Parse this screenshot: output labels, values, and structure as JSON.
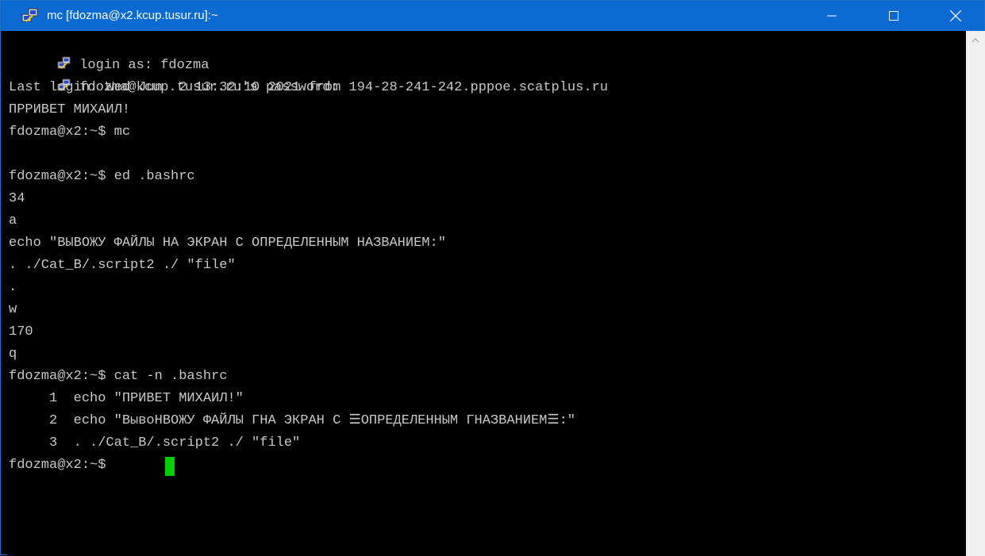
{
  "window": {
    "title": "mc [fdozma@x2.kcup.tusur.ru]:~",
    "icon": "putty-icon",
    "accent_color": "#0a6ad1"
  },
  "controls": {
    "minimize_icon": "minimize-icon",
    "maximize_icon": "maximize-icon",
    "close_icon": "close-icon"
  },
  "terminal": {
    "foreground": "#c8c8c8",
    "background": "#000000",
    "cursor_color": "#00d000",
    "lines": [
      {
        "icon": "putty-icon",
        "text": "login as: fdozma"
      },
      {
        "icon": "putty-icon",
        "text": "fdozma@kcup.tusur.ru's password:"
      },
      {
        "text": "Last login: Wed Jun  2 13:32:10 2021 from 194-28-241-242.pppoe.scatplus.ru"
      },
      {
        "text": "ПРРИВЕТ МИХАИЛ!"
      },
      {
        "text": "fdozma@x2:~$ mc"
      },
      {
        "text": ""
      },
      {
        "text": "fdozma@x2:~$ ed .bashrc"
      },
      {
        "text": "34"
      },
      {
        "text": "a"
      },
      {
        "text": "echo \"ВЫВОЖУ ФАЙЛЫ НА ЭКРАН С ОПРЕДЕЛЕННЫМ НАЗВАНИЕМ:\""
      },
      {
        "text": ". ./Cat_B/.script2 ./ \"file\""
      },
      {
        "text": "."
      },
      {
        "text": "w"
      },
      {
        "text": "170"
      },
      {
        "text": "q"
      },
      {
        "text": "fdozma@x2:~$ cat -n .bashrc"
      },
      {
        "text": "     1  echo \"ПРИВЕТ МИХАИЛ!\""
      },
      {
        "text": "     2  echo \"ВывоНВОЖУ ФАЙЛЫ ГНА ЭКРАН С ☰ОПРЕДЕЛЕННЫМ ГНАЗВАНИЕМ☰:\""
      },
      {
        "text": "     3  . ./Cat_B/.script2 ./ \"file\""
      },
      {
        "text": "fdozma@x2:~$ "
      }
    ]
  }
}
